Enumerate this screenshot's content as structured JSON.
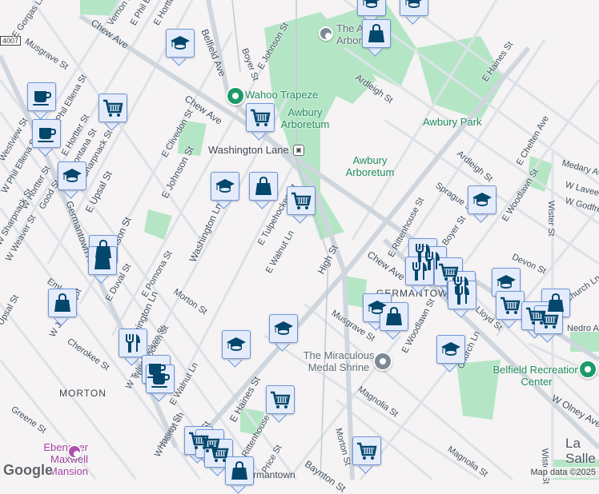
{
  "map": {
    "streets": [
      "Chew Ave",
      "Chew Ave",
      "Chew Ave",
      "Musgrave St",
      "Musgrave St",
      "E Gorgas Ln",
      "Vernon Rd",
      "E Phil Ellena St",
      "E Hortter St",
      "Belfield Ave",
      "Boyer St",
      "E Johnson St",
      "E Johnson St",
      "E Johnson St",
      "E Clivedon St",
      "Phil Ellena St",
      "E Hortter St",
      "Montana St",
      "Sharpnack St",
      "E Upsal St",
      "Germantown Ave",
      "W Phil Ellena St",
      "W Hortter St",
      "Good St",
      "Westview St",
      "Washington Ln",
      "Washington Ln",
      "E Tulpehocken St",
      "E Walnut Ln",
      "High St",
      "High St",
      "Ardleigh St",
      "Ardleigh St",
      "E Haines St",
      "E Haines St",
      "Sprague St",
      "E Chelten Ave",
      "Medary Ave",
      "W Laveer St",
      "W Godfrey Ave",
      "E Woodlawn St",
      "Wister St",
      "Wister St",
      "Devon St",
      "Church Ln",
      "Church Ln",
      "Nedro Ave",
      "W Olney Ave",
      "Magnolia St",
      "Magnolia St",
      "Morton St",
      "Morton St",
      "E Woodlawn St",
      "E Rittenhouse St",
      "Boyer St",
      "E Duval St",
      "E Pomona St",
      "W Sharpnack St",
      "W Weaver St",
      "Emlen St",
      "Upsal St",
      "W Johnson St",
      "Cherokee St",
      "W Tulpehocken St",
      "W Walnut Ln",
      "Greene St",
      "Harvey St",
      "Price St",
      "Rittenhouse St",
      "Baynton St",
      "Tulpehocken St",
      "Lloyd St",
      "E Walnut Ln"
    ],
    "route_shield": "4007",
    "places": {
      "wahoo": "Wahoo Trapeze",
      "awbury1": "Awbury Arboretum",
      "awbury2": "Awbury Arboretum",
      "awbury3": "The Awbury Arboretum",
      "awbury_park": "Awbury Park",
      "washington_lane": "Washington Lane",
      "shrine": "The Miraculous Medal Shrine",
      "belfield": "Belfield Recreation Center",
      "ebenezer": "Ebenezer Maxwell Mansion",
      "lasalle": "La Salle University",
      "germantown_station": "Germantown"
    },
    "neighborhoods": {
      "morton": "MORTON",
      "germantown": "GERMANTOWN"
    },
    "markers": [
      {
        "type": "education"
      },
      {
        "type": "grocery"
      },
      {
        "type": "cafe"
      },
      {
        "type": "cafe"
      },
      {
        "type": "education"
      },
      {
        "type": "grocery"
      },
      {
        "type": "education"
      },
      {
        "type": "shopping"
      },
      {
        "type": "grocery"
      },
      {
        "type": "education"
      },
      {
        "type": "education"
      },
      {
        "type": "shopping"
      },
      {
        "type": "shopping"
      },
      {
        "type": "shopping"
      },
      {
        "type": "shopping"
      },
      {
        "type": "restaurant"
      },
      {
        "type": "cafe"
      },
      {
        "type": "cafe"
      },
      {
        "type": "education"
      },
      {
        "type": "education"
      },
      {
        "type": "grocery"
      },
      {
        "type": "education"
      },
      {
        "type": "restaurant"
      },
      {
        "type": "restaurant"
      },
      {
        "type": "restaurant"
      },
      {
        "type": "grocery"
      },
      {
        "type": "restaurant"
      },
      {
        "type": "restaurant"
      },
      {
        "type": "education"
      },
      {
        "type": "shopping"
      },
      {
        "type": "grocery"
      },
      {
        "type": "grocery"
      },
      {
        "type": "grocery"
      },
      {
        "type": "education"
      },
      {
        "type": "shopping"
      },
      {
        "type": "education"
      },
      {
        "type": "grocery"
      },
      {
        "type": "grocery"
      },
      {
        "type": "grocery"
      },
      {
        "type": "grocery"
      },
      {
        "type": "shopping"
      }
    ],
    "attribution": "Map data ©2025",
    "logo": "Google",
    "colors": {
      "park": "#b4e6c6",
      "road": "#d9dee5",
      "marker_bg": "#e4ecfb",
      "marker_icon": "#04476c",
      "poi_green": "#1e8a5a"
    }
  }
}
